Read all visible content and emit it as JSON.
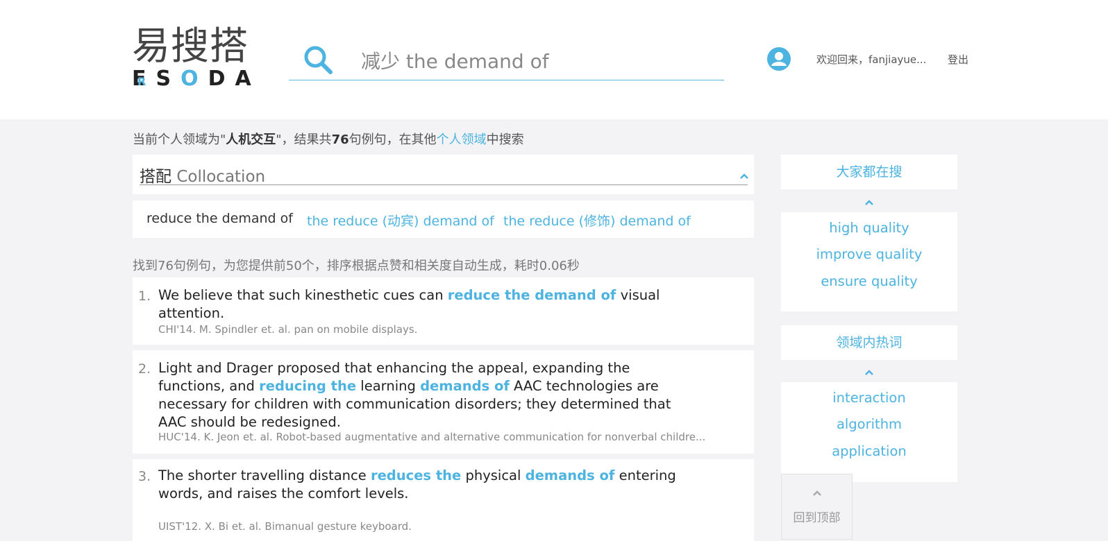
{
  "logo": {
    "cn": "易搜搭",
    "en_prefix": "E",
    "en_q": "R",
    "en_s": "S",
    "en_o": "O",
    "en_rest": "DA"
  },
  "search": {
    "value": "减少 the demand of",
    "placeholder": ""
  },
  "user": {
    "welcome": "欢迎回来，fanjiayue...",
    "logout": "登出"
  },
  "domain_line": {
    "prefix": "当前个人领域为\"",
    "domain": "人机交互",
    "mid": "\"，结果共",
    "count": "76",
    "mid2": "句例句，在其他",
    "link": "个人领域",
    "suffix": "中搜索"
  },
  "collocation": {
    "title_cn": "搭配",
    "title_en": "Collocation",
    "options": [
      "reduce the demand of",
      "the reduce (动宾) demand of",
      "the reduce (修饰) demand of"
    ]
  },
  "found_text": "找到76句例句，为您提供前50个，排序根据点赞和相关度自动生成，耗时0.06秒",
  "results": [
    {
      "num": "1.",
      "parts": [
        "We believe that such kinesthetic cues can ",
        "reduce the demand of",
        " visual attention."
      ],
      "source": "CHI'14. M. Spindler et. al. pan on mobile displays."
    },
    {
      "num": "2.",
      "parts": [
        "Light and Drager proposed that enhancing the appeal, expanding the functions, and ",
        "reducing the",
        " learning ",
        "demands of",
        " AAC technologies are necessary for children with communication disorders; they determined that AAC should be redesigned."
      ],
      "source": "HUC'14. K. Jeon et. al. Robot-based augmentative and alternative communication for nonverbal childre..."
    },
    {
      "num": "3.",
      "parts": [
        "The shorter travelling distance ",
        "reduces the",
        " physical ",
        "demands of",
        " entering words, and raises the comfort levels."
      ],
      "source": "UIST'12. X. Bi et. al. Bimanual gesture keyboard."
    }
  ],
  "sidebar": {
    "popular": {
      "title": "大家都在搜",
      "items": [
        "high quality",
        "improve quality",
        "ensure quality"
      ]
    },
    "hotwords": {
      "title": "领域内热词",
      "items": [
        "interaction",
        "algorithm",
        "application"
      ]
    }
  },
  "back_to_top": "回到顶部",
  "colors": {
    "accent": "#4db3e0",
    "background": "#f3f3f6"
  }
}
